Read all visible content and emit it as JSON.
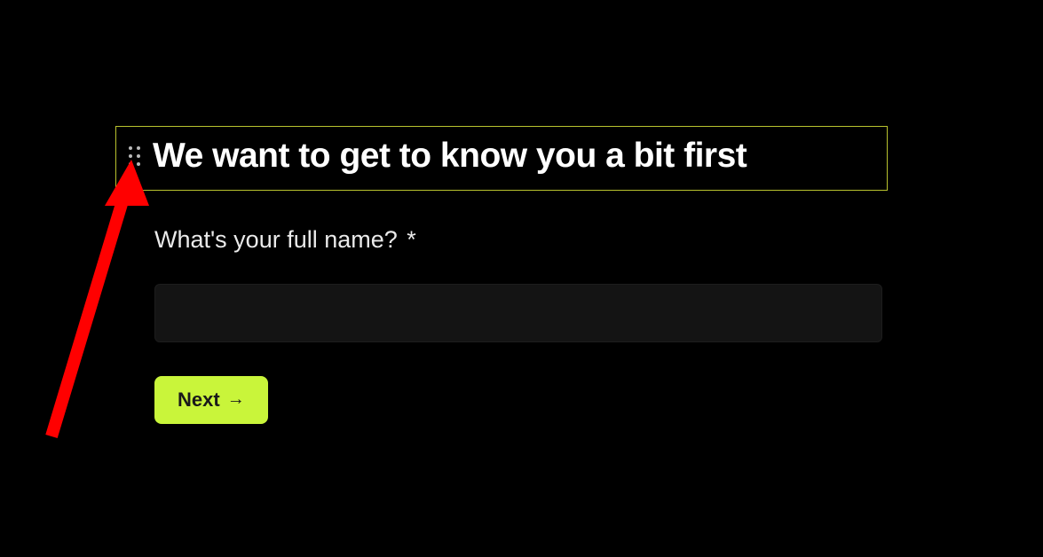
{
  "form": {
    "heading": "We want to get to know you a bit first",
    "question_label": "What's your full name?",
    "required_marker": "*",
    "input_value": "",
    "input_placeholder": "",
    "next_button_label": "Next",
    "next_button_arrow": "→"
  },
  "colors": {
    "accent": "#c9f53a",
    "selection_border": "#b8c22e",
    "annotation": "#ff0000"
  }
}
